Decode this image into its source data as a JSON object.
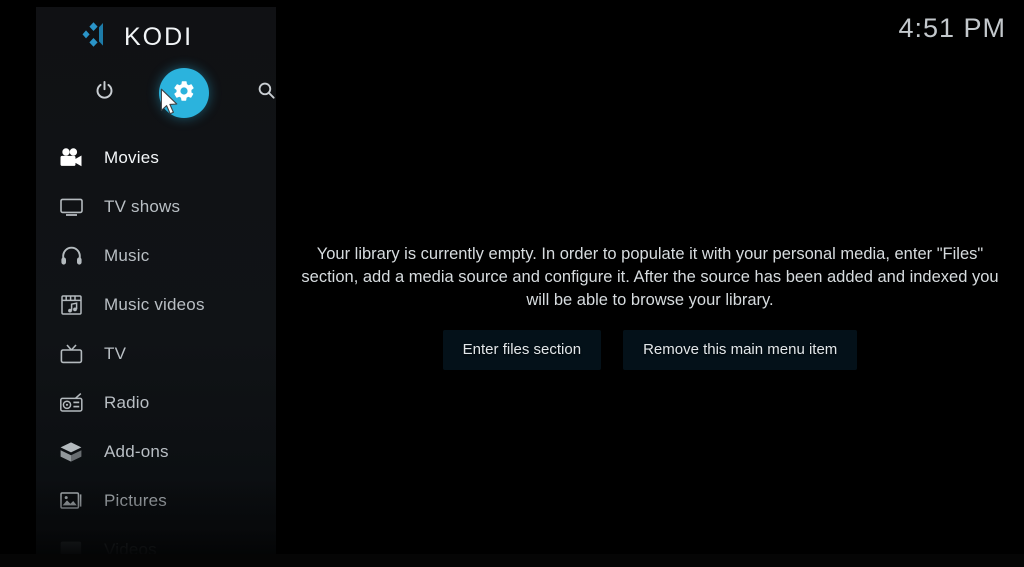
{
  "app": {
    "name": "KODI",
    "logo_icon": "kodi-logo-icon"
  },
  "header": {
    "clock": "4:51 PM"
  },
  "toolbar": {
    "items": [
      {
        "name": "power",
        "icon": "power-icon",
        "label": "Power",
        "active": false
      },
      {
        "name": "settings",
        "icon": "gear-icon",
        "label": "Settings",
        "active": true
      },
      {
        "name": "search",
        "icon": "search-icon",
        "label": "Search",
        "active": false
      }
    ]
  },
  "sidebar": {
    "items": [
      {
        "label": "Movies",
        "icon": "movie-camera-icon",
        "state": "active"
      },
      {
        "label": "TV shows",
        "icon": "television-icon",
        "state": "normal"
      },
      {
        "label": "Music",
        "icon": "headphones-icon",
        "state": "normal"
      },
      {
        "label": "Music videos",
        "icon": "music-video-icon",
        "state": "normal"
      },
      {
        "label": "TV",
        "icon": "tv-antenna-icon",
        "state": "normal"
      },
      {
        "label": "Radio",
        "icon": "radio-icon",
        "state": "normal"
      },
      {
        "label": "Add-ons",
        "icon": "package-box-icon",
        "state": "normal"
      },
      {
        "label": "Pictures",
        "icon": "picture-icon",
        "state": "normal"
      },
      {
        "label": "Videos",
        "icon": "film-strip-icon",
        "state": "dim"
      }
    ]
  },
  "main": {
    "empty_message": "Your library is currently empty. In order to populate it with your personal media, enter \"Files\" section, add a media source and configure it. After the source has been added and indexed you will be able to browse your library.",
    "buttons": [
      {
        "label": "Enter files section",
        "name": "enter-files-section-button"
      },
      {
        "label": "Remove this main menu item",
        "name": "remove-main-menu-item-button"
      }
    ]
  },
  "colors": {
    "accent": "#2bb3dd",
    "sidebar_bg": "#101316",
    "content_bg": "#115067",
    "text": "#b9bfc4",
    "text_active": "#f4f7f9"
  },
  "pointer": {
    "icon": "mouse-cursor-icon"
  }
}
